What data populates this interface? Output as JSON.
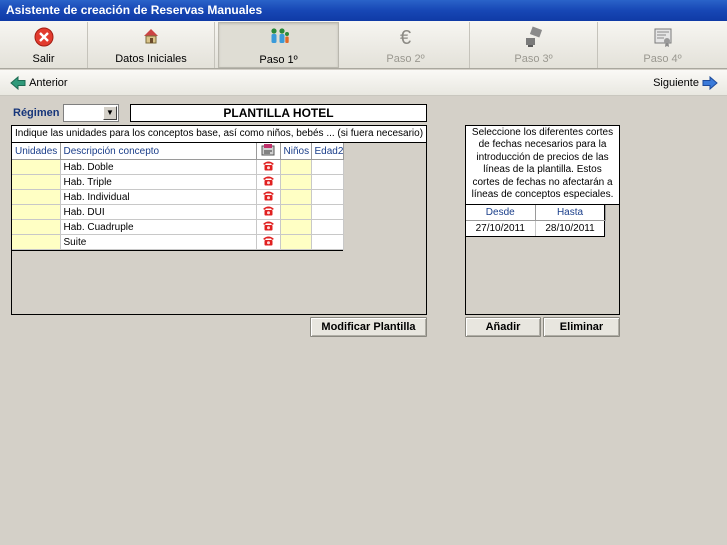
{
  "window": {
    "title": "Asistente de creación de Reservas Manuales"
  },
  "toolbar": {
    "buttons": [
      {
        "label": "Salir",
        "icon": "close-circle-icon",
        "state": "enabled"
      },
      {
        "label": "Datos Iniciales",
        "icon": "house-icon",
        "state": "enabled"
      },
      {
        "label": "Paso 1º",
        "icon": "people-icon",
        "state": "active"
      },
      {
        "label": "Paso 2º",
        "icon": "euro-icon",
        "state": "disabled"
      },
      {
        "label": "Paso 3º",
        "icon": "stamp-icon",
        "state": "disabled"
      },
      {
        "label": "Paso 4º",
        "icon": "certificate-icon",
        "state": "disabled"
      }
    ]
  },
  "nav": {
    "prev_label": "Anterior",
    "next_label": "Siguiente"
  },
  "regimen": {
    "label": "Régimen",
    "value": ""
  },
  "plantilla": {
    "title": "PLANTILLA HOTEL"
  },
  "conceptos": {
    "instruction": "Indique las unidades para los conceptos base, así como niños, bebés ... (si fuera necesario)",
    "columns": {
      "unidades": "Unidades",
      "descripcion": "Descripción concepto",
      "ninos": "Niños",
      "edad2": "Edad2"
    },
    "rows": [
      {
        "unidades": "",
        "descripcion": "Hab. Doble",
        "ninos": "",
        "edad2": ""
      },
      {
        "unidades": "",
        "descripcion": "Hab. Triple",
        "ninos": "",
        "edad2": ""
      },
      {
        "unidades": "",
        "descripcion": "Hab. Individual",
        "ninos": "",
        "edad2": ""
      },
      {
        "unidades": "",
        "descripcion": "Hab. DUI",
        "ninos": "",
        "edad2": ""
      },
      {
        "unidades": "",
        "descripcion": "Hab. Cuadruple",
        "ninos": "",
        "edad2": ""
      },
      {
        "unidades": "",
        "descripcion": "Suite",
        "ninos": "",
        "edad2": ""
      }
    ]
  },
  "buttons": {
    "modificar_label": "Modificar Plantilla",
    "anadir_label": "Añadir",
    "eliminar_label": "Eliminar"
  },
  "fechas": {
    "message": "Seleccione los diferentes cortes de fechas necesarios para la introducción de precios de las líneas de la plantilla. Estos cortes de fechas no afectarán a líneas de conceptos especiales.",
    "columns": {
      "desde": "Desde",
      "hasta": "Hasta"
    },
    "rows": [
      {
        "desde": "27/10/2011",
        "hasta": "28/10/2011"
      }
    ]
  },
  "colors": {
    "title_bar": "#1747b5",
    "header_text": "#1a3e8a",
    "editable_cell": "#ffffc4",
    "phone_icon": "#e02020",
    "nav_arrow": "#2f9a7a"
  }
}
